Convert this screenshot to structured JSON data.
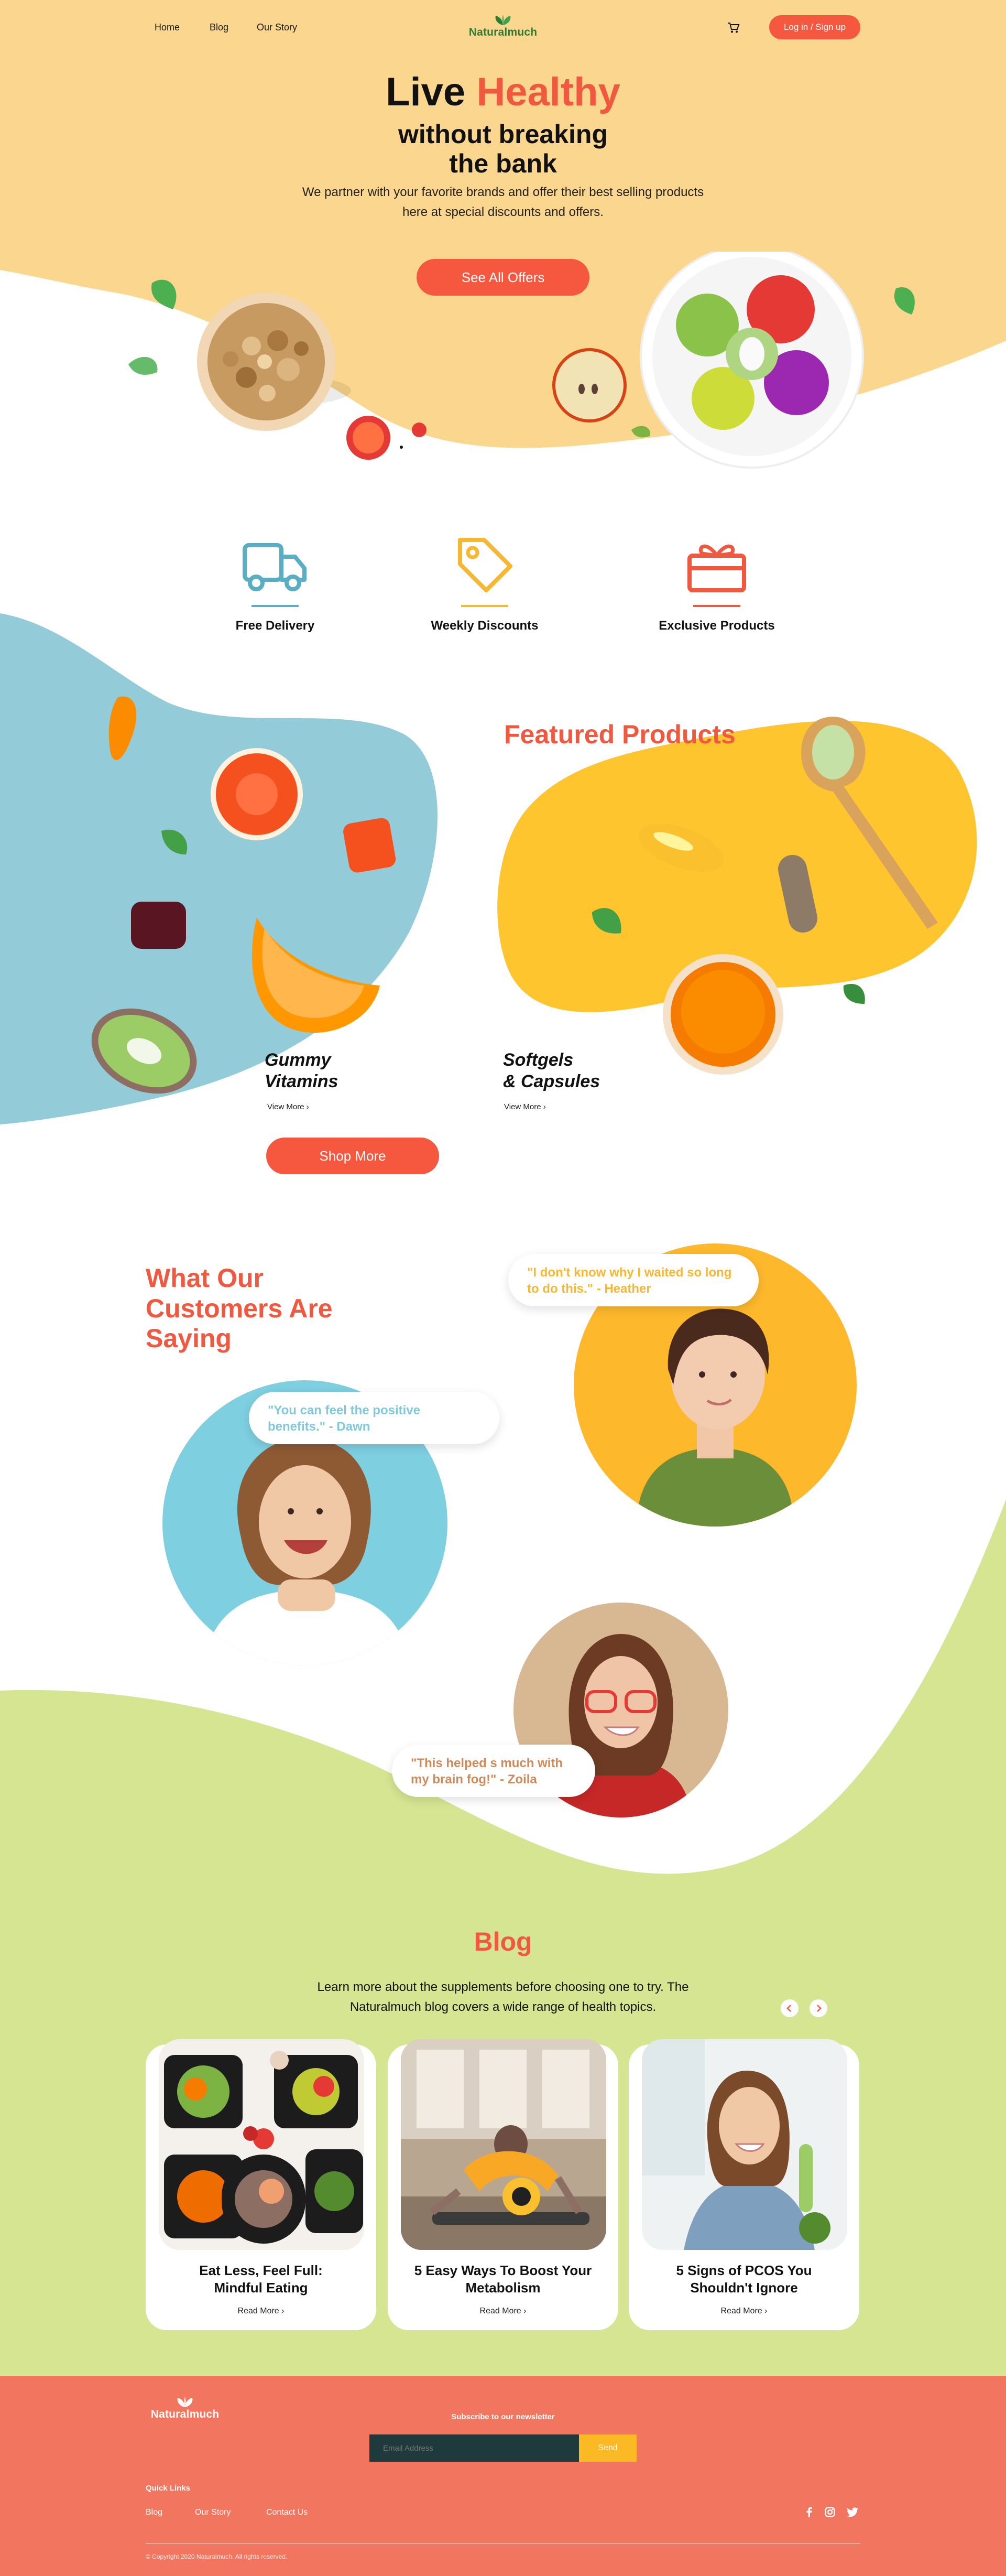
{
  "nav": {
    "links": [
      "Home",
      "Blog",
      "Our Story"
    ],
    "logo_text": "Naturalmuch",
    "cart_icon": "cart-icon",
    "login_label": "Log in / Sign up"
  },
  "hero": {
    "title_part1": "Live",
    "title_part2": "Healthy",
    "subtitle_line1": "without breaking",
    "subtitle_line2": "the bank",
    "description": "We partner with your favorite brands and offer their best selling products here at special discounts and offers.",
    "cta_label": "See All Offers"
  },
  "features": [
    {
      "label": "Free Delivery",
      "icon": "truck-icon",
      "color": "#5aaec3"
    },
    {
      "label": "Weekly Discounts",
      "icon": "tag-icon",
      "color": "#f7b731"
    },
    {
      "label": "Exclusive Products",
      "icon": "gift-icon",
      "color": "#f0593f"
    }
  ],
  "featured": {
    "title": "Featured Products",
    "products": [
      {
        "name_line1": "Gummy",
        "name_line2": "Vitamins",
        "link": "View More ›"
      },
      {
        "name_line1": "Softgels",
        "name_line2": "& Capsules",
        "link": "View More ›"
      }
    ],
    "shop_more_label": "Shop More"
  },
  "testimonials": {
    "title_line1": "What Our",
    "title_line2": "Customers Are",
    "title_line3": "Saying",
    "quotes": [
      {
        "text": "\"I don't know why I waited so long to do this.\" - Heather",
        "color": "#f7b731"
      },
      {
        "text": "\"You can feel the positive benefits.\" - Dawn",
        "color": "#7ec9db"
      },
      {
        "text": "\"This helped s much with my brain fog!\" - Zoila",
        "color": "#d08a5a"
      }
    ]
  },
  "blog": {
    "title": "Blog",
    "description": "Learn more about the supplements before choosing one to try. The Naturalmuch blog covers a wide range of health topics.",
    "prev_icon": "chevron-left-icon",
    "next_icon": "chevron-right-icon",
    "posts": [
      {
        "title_line1": "Eat Less, Feel Full:",
        "title_line2": "Mindful Eating",
        "link": "Read More ›"
      },
      {
        "title_line1": "5 Easy Ways To Boost Your",
        "title_line2": "Metabolism",
        "link": "Read More ›"
      },
      {
        "title_line1": "5 Signs of PCOS You",
        "title_line2": "Shouldn't Ignore",
        "link": "Read More ›"
      }
    ]
  },
  "footer": {
    "logo_text": "Naturalmuch",
    "newsletter_label": "Subscribe to our newsletter",
    "email_placeholder": "Email Address",
    "send_label": "Send",
    "quick_links_title": "Quick Links",
    "links": [
      "Blog",
      "Our Story",
      "Contact Us"
    ],
    "social_icons": [
      "facebook-icon",
      "instagram-icon",
      "twitter-icon"
    ],
    "copyright": "© Copyright 2020 Naturalmuch. All rights reserved."
  },
  "colors": {
    "accent": "#f6573f",
    "hero_bg": "#fad68f",
    "blue_blob": "#93cbd8",
    "yellow_blob": "#fec52e",
    "green_wave": "#d5e591",
    "footer_bg": "#f2765f"
  }
}
